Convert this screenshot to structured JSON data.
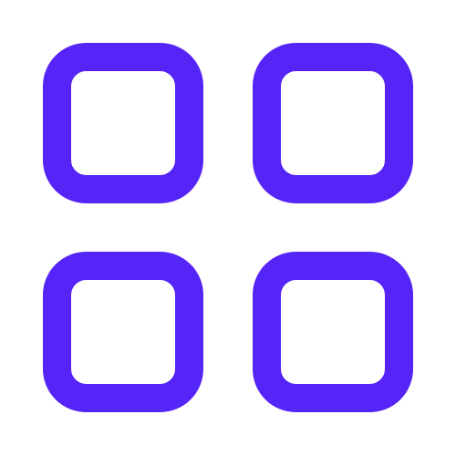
{
  "icon": {
    "name": "grid-icon",
    "description_semantic": "app-grid",
    "color": "#5524F6",
    "background": "#FFFFFF"
  }
}
